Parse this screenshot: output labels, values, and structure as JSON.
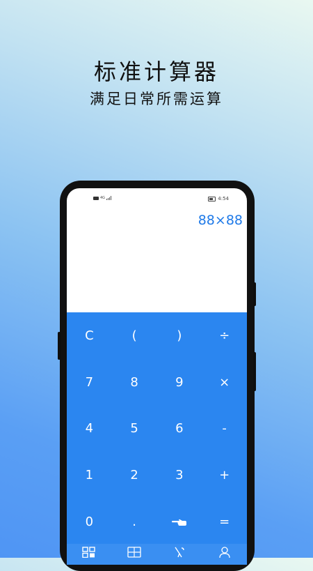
{
  "promo": {
    "title": "标准计算器",
    "subtitle": "满足日常所需运算"
  },
  "status_bar": {
    "network": "4G",
    "battery": "70",
    "time": "4:54"
  },
  "display": {
    "expression": "88×88"
  },
  "keypad": {
    "keys": [
      "C",
      "(",
      ")",
      "÷",
      "7",
      "8",
      "9",
      "×",
      "4",
      "5",
      "6",
      "-",
      "1",
      "2",
      "3",
      "+",
      "0",
      ".",
      "",
      "="
    ],
    "backspace_icon": "pointing-hand-icon"
  },
  "tabbar": {
    "icons": [
      "calculator-icon",
      "converter-grid-icon",
      "tools-icon",
      "user-icon"
    ]
  },
  "colors": {
    "accent": "#2b86f0",
    "display_text": "#1f7ae8"
  }
}
